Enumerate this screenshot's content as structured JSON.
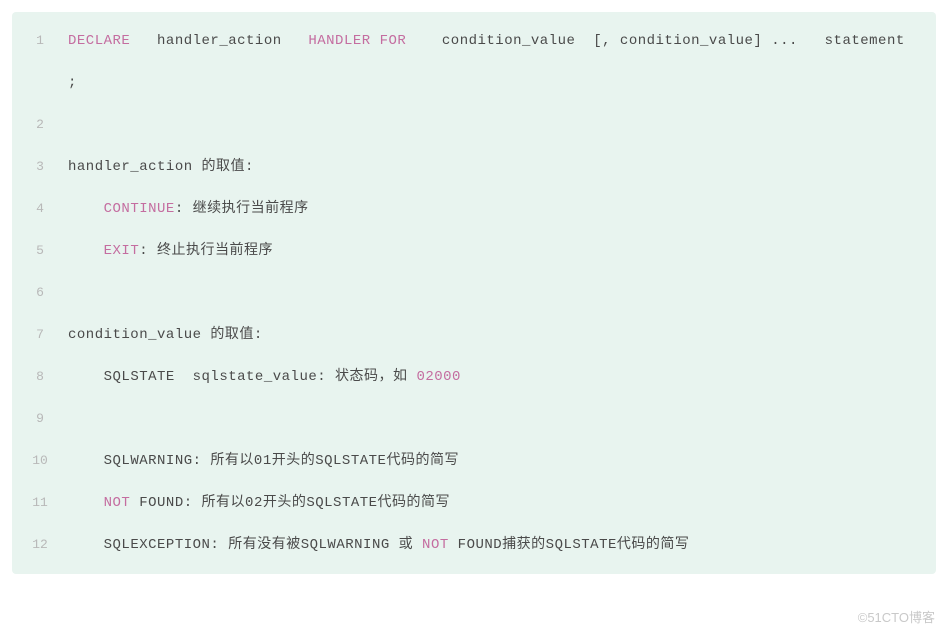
{
  "watermark": "©51CTO博客",
  "lines": [
    {
      "num": "1",
      "segments": [
        {
          "t": "DECLARE",
          "c": "kw"
        },
        {
          "t": "   handler_action   ",
          "c": "txt"
        },
        {
          "t": "HANDLER",
          "c": "kw"
        },
        {
          "t": " ",
          "c": "txt"
        },
        {
          "t": "FOR",
          "c": "kw"
        },
        {
          "t": "    condition_value  [, condition_value] ...   statement ;",
          "c": "txt"
        }
      ]
    },
    {
      "num": "2",
      "segments": [
        {
          "t": "",
          "c": "txt"
        }
      ]
    },
    {
      "num": "3",
      "segments": [
        {
          "t": "handler_action 的取值: ",
          "c": "txt"
        }
      ]
    },
    {
      "num": "4",
      "segments": [
        {
          "t": "    ",
          "c": "txt"
        },
        {
          "t": "CONTINUE",
          "c": "kw"
        },
        {
          "t": ": 继续执行当前程序",
          "c": "txt"
        }
      ]
    },
    {
      "num": "5",
      "segments": [
        {
          "t": "    ",
          "c": "txt"
        },
        {
          "t": "EXIT",
          "c": "kw"
        },
        {
          "t": ": 终止执行当前程序",
          "c": "txt"
        }
      ]
    },
    {
      "num": "6",
      "segments": [
        {
          "t": "",
          "c": "txt"
        }
      ]
    },
    {
      "num": "7",
      "segments": [
        {
          "t": "condition_value 的取值: ",
          "c": "txt"
        }
      ]
    },
    {
      "num": "8",
      "segments": [
        {
          "t": "    SQLSTATE  sqlstate_value: 状态码，如 ",
          "c": "txt"
        },
        {
          "t": "02000",
          "c": "kw"
        }
      ]
    },
    {
      "num": "9",
      "segments": [
        {
          "t": "",
          "c": "txt"
        }
      ]
    },
    {
      "num": "10",
      "segments": [
        {
          "t": "    SQLWARNING: 所有以01开头的SQLSTATE代码的简写",
          "c": "txt"
        }
      ]
    },
    {
      "num": "11",
      "segments": [
        {
          "t": "    ",
          "c": "txt"
        },
        {
          "t": "NOT",
          "c": "kw"
        },
        {
          "t": " FOUND: 所有以02开头的SQLSTATE代码的简写",
          "c": "txt"
        }
      ]
    },
    {
      "num": "12",
      "segments": [
        {
          "t": "    SQLEXCEPTION: 所有没有被SQLWARNING 或 ",
          "c": "txt"
        },
        {
          "t": "NOT",
          "c": "kw"
        },
        {
          "t": " FOUND捕获的SQLSTATE代码的简写",
          "c": "txt"
        }
      ]
    }
  ]
}
